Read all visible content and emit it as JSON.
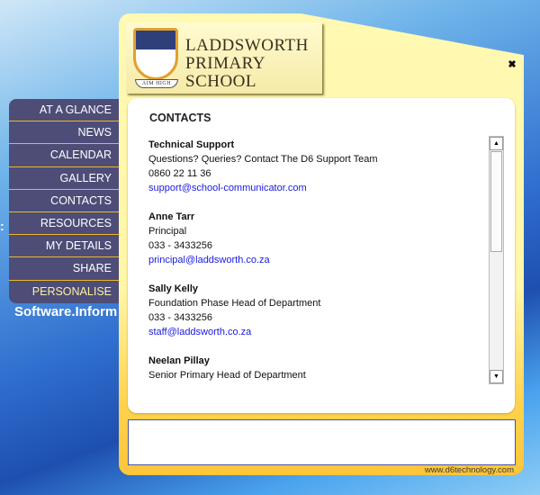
{
  "background": {
    "colon": ":",
    "watermark": "Software.Inform"
  },
  "menu": [
    {
      "label": "AT A GLANCE"
    },
    {
      "label": "NEWS"
    },
    {
      "label": "CALENDAR"
    },
    {
      "label": "GALLERY"
    },
    {
      "label": "CONTACTS"
    },
    {
      "label": "RESOURCES"
    },
    {
      "label": "MY DETAILS"
    },
    {
      "label": "SHARE"
    },
    {
      "label": "PERSONALISE"
    }
  ],
  "header": {
    "school_line1": "LADDSWORTH",
    "school_line2": "PRIMARY SCHOOL",
    "crest_motto": "AIM HIGH",
    "close_icon": "✖"
  },
  "main": {
    "title": "CONTACTS",
    "contacts": [
      {
        "name": "Technical Support",
        "role": "Questions? Queries? Contact The D6 Support Team",
        "phone": "0860 22 11 36",
        "email": "support@school-communicator.com"
      },
      {
        "name": "Anne Tarr",
        "role": "Principal",
        "phone": "033 - 3433256",
        "email": "principal@laddsworth.co.za"
      },
      {
        "name": "Sally Kelly",
        "role": "Foundation Phase Head of Department",
        "phone": "033 - 3433256",
        "email": "staff@laddsworth.co.za"
      },
      {
        "name": "Neelan Pillay",
        "role": "Senior Primary Head of Department",
        "phone": "",
        "email": ""
      }
    ]
  },
  "footer": {
    "url": "www.d6technology.com"
  }
}
